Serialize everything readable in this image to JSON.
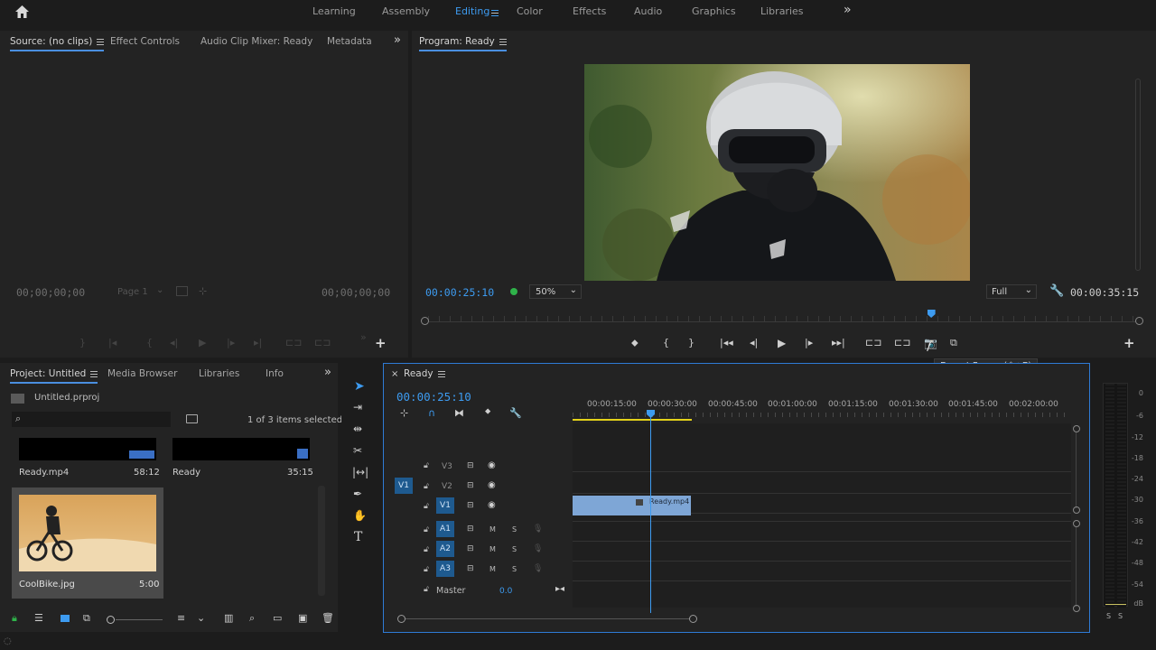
{
  "topbar": {
    "tabs": [
      "Learning",
      "Assembly",
      "Editing",
      "Color",
      "Effects",
      "Audio",
      "Graphics",
      "Libraries"
    ],
    "active_tab": "Editing",
    "more": "»"
  },
  "source": {
    "tabs": [
      "Source: (no clips)",
      "Effect Controls",
      "Audio Clip Mixer: Ready",
      "Metadata"
    ],
    "timecode_left": "00;00;00;00",
    "timecode_right": "00;00;00;00",
    "page": "Page 1"
  },
  "program": {
    "title": "Program: Ready",
    "timecode": "00:00:25:10",
    "zoom": "50%",
    "quality": "Full",
    "duration": "00:00:35:15",
    "tooltip": "Export Frame (⇧+E)",
    "playhead_fraction": 0.71
  },
  "project": {
    "tabs": [
      "Project: Untitled",
      "Media Browser",
      "Libraries",
      "Info"
    ],
    "file": "Untitled.prproj",
    "items_selected": "1 of 3 items selected",
    "items": [
      {
        "name": "Ready.mp4",
        "duration": "58:12"
      },
      {
        "name": "Ready",
        "duration": "35:15"
      },
      {
        "name": "CoolBike.jpg",
        "duration": "5:00"
      }
    ]
  },
  "timeline": {
    "title": "Ready",
    "timecode": "00:00:25:10",
    "ruler": [
      "00:00:15:00",
      "00:00:30:00",
      "00:00:45:00",
      "00:01:00:00",
      "00:01:15:00",
      "00:01:30:00",
      "00:01:45:00",
      "00:02:00:00"
    ],
    "video_tracks": [
      "V3",
      "V2",
      "V1"
    ],
    "source_patch": "V1",
    "audio_tracks": [
      "A1",
      "A2",
      "A3"
    ],
    "mute": "M",
    "solo": "S",
    "master_label": "Master",
    "master_value": "0.0",
    "clip_name": "Ready.mp4"
  },
  "meters": {
    "scale": [
      "0",
      "-6",
      "-12",
      "-18",
      "-24",
      "-30",
      "-36",
      "-42",
      "-48",
      "-54",
      "dB"
    ],
    "solo_labels": [
      "S",
      "S"
    ]
  },
  "colors": {
    "accent": "#3d9bf0",
    "clip": "#7ea6d6",
    "track_badge": "#1e5a8f",
    "panel_border": "#2e7bd6"
  }
}
